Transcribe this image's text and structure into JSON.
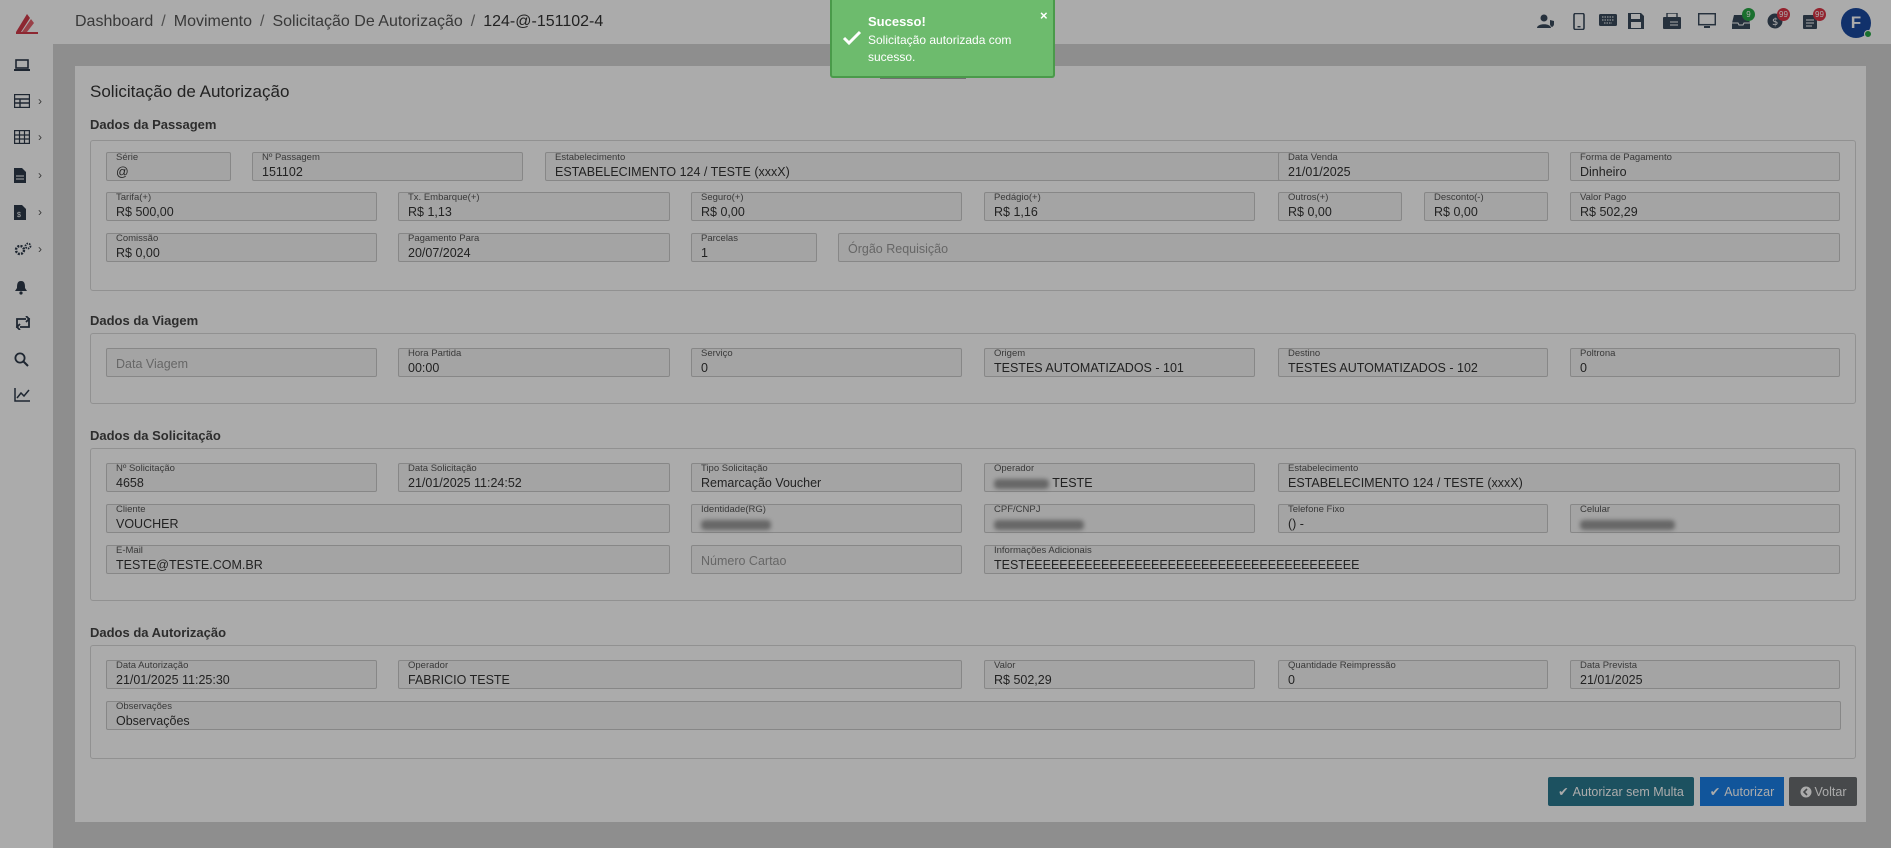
{
  "breadcrumb": {
    "items": [
      "Dashboard",
      "Movimento",
      "Solicitação De Autorização"
    ],
    "current": "124-@-151102-4"
  },
  "header": {
    "avatar_initial": "F",
    "badges": {
      "notifications_green": "9",
      "alerts_red_1": "99",
      "alerts_red_2": "99"
    }
  },
  "page_title": "Solicitação de Autorização",
  "sections": {
    "passagem": {
      "title": "Dados da Passagem",
      "serie": {
        "label": "Série",
        "value": "@"
      },
      "num_passagem": {
        "label": "Nº Passagem",
        "value": "151102"
      },
      "estabelecimento": {
        "label": "Estabelecimento",
        "value": "ESTABELECIMENTO 124 / TESTE (xxxX)"
      },
      "data_venda": {
        "label": "Data Venda",
        "value": "21/01/2025"
      },
      "forma_pagamento": {
        "label": "Forma de Pagamento",
        "value": "Dinheiro"
      },
      "tarifa": {
        "label": "Tarifa(+)",
        "value": "R$ 500,00"
      },
      "tx_embarque": {
        "label": "Tx. Embarque(+)",
        "value": "R$ 1,13"
      },
      "seguro": {
        "label": "Seguro(+)",
        "value": "R$ 0,00"
      },
      "pedagio": {
        "label": "Pedágio(+)",
        "value": "R$ 1,16"
      },
      "outros": {
        "label": "Outros(+)",
        "value": "R$ 0,00"
      },
      "desconto": {
        "label": "Desconto(-)",
        "value": "R$ 0,00"
      },
      "valor_pago": {
        "label": "Valor Pago",
        "value": "R$ 502,29"
      },
      "comissao": {
        "label": "Comissão",
        "value": "R$ 0,00"
      },
      "pagamento_para": {
        "label": "Pagamento Para",
        "value": "20/07/2024"
      },
      "parcelas": {
        "label": "Parcelas",
        "value": "1"
      },
      "orgao_requisicao": {
        "placeholder": "Órgão Requisição"
      }
    },
    "viagem": {
      "title": "Dados da Viagem",
      "data_viagem": {
        "placeholder": "Data Viagem"
      },
      "hora_partida": {
        "label": "Hora Partida",
        "value": "00:00"
      },
      "servico": {
        "label": "Serviço",
        "value": "0"
      },
      "origem": {
        "label": "Origem",
        "value": "TESTES AUTOMATIZADOS - 101"
      },
      "destino": {
        "label": "Destino",
        "value": "TESTES AUTOMATIZADOS - 102"
      },
      "poltrona": {
        "label": "Poltrona",
        "value": "0"
      }
    },
    "solicitacao": {
      "title": "Dados da Solicitação",
      "num_solicitacao": {
        "label": "Nº Solicitação",
        "value": "4658"
      },
      "data_solicitacao": {
        "label": "Data Solicitação",
        "value": "21/01/2025 11:24:52"
      },
      "tipo_solicitacao": {
        "label": "Tipo Solicitação",
        "value": "Remarcação Voucher"
      },
      "operador": {
        "label": "Operador",
        "value": "TESTE"
      },
      "estabelecimento": {
        "label": "Estabelecimento",
        "value": "ESTABELECIMENTO 124 / TESTE (xxxX)"
      },
      "cliente": {
        "label": "Cliente",
        "value": "VOUCHER"
      },
      "identidade": {
        "label": "Identidade(RG)"
      },
      "cpf_cnpj": {
        "label": "CPF/CNPJ"
      },
      "telefone_fixo": {
        "label": "Telefone Fixo",
        "value": "() -"
      },
      "celular": {
        "label": "Celular"
      },
      "email": {
        "label": "E-Mail",
        "value": "TESTE@TESTE.COM.BR"
      },
      "numero_cartao": {
        "placeholder": "Número Cartao"
      },
      "info_adicionais": {
        "label": "Informações Adicionais",
        "value": "TESTEEEEEEEEEEEEEEEEEEEEEEEEEEEEEEEEEEEEEEEE"
      }
    },
    "autorizacao": {
      "title": "Dados da Autorização",
      "data_autorizacao": {
        "label": "Data Autorização",
        "value": "21/01/2025 11:25:30"
      },
      "operador": {
        "label": "Operador",
        "value": "FABRICIO TESTE"
      },
      "valor": {
        "label": "Valor",
        "value": "R$ 502,29"
      },
      "qtd_reimpressao": {
        "label": "Quantidade Reimpressão",
        "value": "0"
      },
      "data_prevista": {
        "label": "Data Prevista",
        "value": "21/01/2025"
      },
      "observacoes": {
        "label": "Observações",
        "value": "Observações"
      }
    }
  },
  "actions": {
    "autorizar_sem_multa": "Autorizar sem Multa",
    "autorizar": "Autorizar",
    "voltar": "Voltar"
  },
  "toast": {
    "title": "Sucesso!",
    "message": "Solicitação autorizada com sucesso.",
    "close": "×"
  },
  "colors": {
    "toast_bg": "#6dbb6d",
    "primary_button": "#1a7fe8",
    "teal_button": "#2a7a90",
    "secondary_button": "#6b6e70",
    "avatar_bg": "#1a4aa0"
  }
}
